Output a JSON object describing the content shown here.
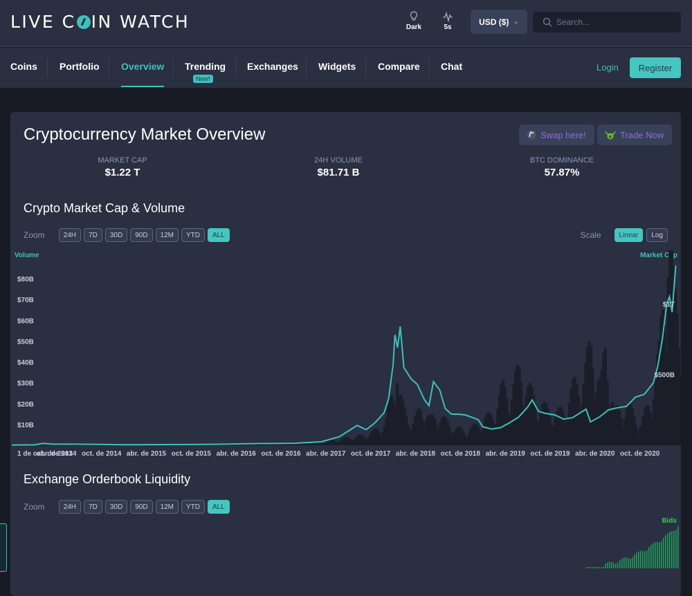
{
  "header": {
    "logo_left": "LIVE C",
    "logo_right": "IN WATCH",
    "theme_label": "Dark",
    "refresh_label": "5s",
    "currency": "USD ($)",
    "search_placeholder": "Search..."
  },
  "nav": {
    "items": [
      {
        "label": "Coins"
      },
      {
        "label": "Portfolio"
      },
      {
        "label": "Overview",
        "active": true
      },
      {
        "label": "Trending",
        "badge": "New!"
      },
      {
        "label": "Exchanges"
      },
      {
        "label": "Widgets"
      },
      {
        "label": "Compare"
      },
      {
        "label": "Chat"
      }
    ],
    "login": "Login",
    "register": "Register"
  },
  "overview": {
    "title": "Cryptocurrency Market Overview",
    "promos": [
      {
        "label": "Swap here!",
        "icon": "swap-logo-icon"
      },
      {
        "label": "Trade Now",
        "icon": "trade-logo-icon"
      }
    ],
    "stats": [
      {
        "label": "MARKET CAP",
        "value": "$1.22 T"
      },
      {
        "label": "24H VOLUME",
        "value": "$81.71 B"
      },
      {
        "label": "BTC DOMINANCE",
        "value": "57.87%"
      }
    ]
  },
  "market_chart": {
    "title": "Crypto Market Cap & Volume",
    "zoom_label": "Zoom",
    "zoom_options": [
      "24H",
      "7D",
      "30D",
      "90D",
      "12M",
      "YTD",
      "ALL"
    ],
    "zoom_selected": "ALL",
    "scale_label": "Scale",
    "scale_options": [
      "Linear",
      "Log"
    ],
    "scale_selected": "Linear",
    "left_axis_title": "Volume",
    "right_axis_title": "Market Cap"
  },
  "orderbook": {
    "title": "Exchange Orderbook Liquidity",
    "zoom_label": "Zoom",
    "zoom_options": [
      "24H",
      "7D",
      "30D",
      "90D",
      "12M",
      "YTD",
      "ALL"
    ],
    "zoom_selected": "ALL",
    "series_label": "Bids"
  },
  "chart_data": {
    "type": "area",
    "title": "Crypto Market Cap & Volume",
    "xlabel": "",
    "ylabel": "Volume",
    "y2label": "Market Cap",
    "grid": false,
    "legend": "none",
    "yticks": [
      "$10B",
      "$20B",
      "$30B",
      "$40B",
      "$50B",
      "$60B",
      "$70B",
      "$80B"
    ],
    "ylim": [
      0,
      87
    ],
    "y2ticks": [
      "$500B",
      "$1T"
    ],
    "y2lim": [
      0,
      1280
    ],
    "xticks": [
      "1 de oct. de 2013",
      "abr. de 2014",
      "oct. de 2014",
      "abr. de 2015",
      "oct. de 2015",
      "abr. de 2016",
      "oct. de 2016",
      "abr. de 2017",
      "oct. de 2017",
      "abr. de 2018",
      "oct. de 2018",
      "abr. de 2019",
      "oct. de 2019",
      "abr. de 2020",
      "oct. de 2020"
    ],
    "x_range": [
      2013.75,
      2021.2
    ],
    "series": [
      {
        "name": "Market Cap",
        "unit": "billion USD",
        "color": "#3fc1bb",
        "points": [
          [
            2013.75,
            2
          ],
          [
            2014.0,
            3
          ],
          [
            2014.1,
            13
          ],
          [
            2014.2,
            8
          ],
          [
            2014.5,
            8
          ],
          [
            2015.0,
            4
          ],
          [
            2015.5,
            5
          ],
          [
            2016.0,
            7
          ],
          [
            2016.5,
            12
          ],
          [
            2016.9,
            14
          ],
          [
            2017.2,
            25
          ],
          [
            2017.4,
            60
          ],
          [
            2017.5,
            100
          ],
          [
            2017.6,
            140
          ],
          [
            2017.7,
            110
          ],
          [
            2017.8,
            160
          ],
          [
            2017.9,
            230
          ],
          [
            2017.95,
            330
          ],
          [
            2018.0,
            570
          ],
          [
            2018.02,
            780
          ],
          [
            2018.05,
            690
          ],
          [
            2018.08,
            840
          ],
          [
            2018.12,
            550
          ],
          [
            2018.2,
            470
          ],
          [
            2018.27,
            430
          ],
          [
            2018.35,
            320
          ],
          [
            2018.4,
            280
          ],
          [
            2018.45,
            450
          ],
          [
            2018.52,
            390
          ],
          [
            2018.58,
            260
          ],
          [
            2018.65,
            220
          ],
          [
            2018.72,
            220
          ],
          [
            2018.8,
            215
          ],
          [
            2018.87,
            200
          ],
          [
            2018.95,
            180
          ],
          [
            2019.0,
            130
          ],
          [
            2019.1,
            115
          ],
          [
            2019.2,
            125
          ],
          [
            2019.3,
            160
          ],
          [
            2019.4,
            200
          ],
          [
            2019.5,
            270
          ],
          [
            2019.55,
            320
          ],
          [
            2019.62,
            240
          ],
          [
            2019.7,
            225
          ],
          [
            2019.8,
            215
          ],
          [
            2019.9,
            185
          ],
          [
            2020.0,
            195
          ],
          [
            2020.15,
            255
          ],
          [
            2020.2,
            165
          ],
          [
            2020.3,
            200
          ],
          [
            2020.4,
            250
          ],
          [
            2020.5,
            265
          ],
          [
            2020.6,
            275
          ],
          [
            2020.7,
            340
          ],
          [
            2020.8,
            360
          ],
          [
            2020.9,
            440
          ],
          [
            2020.95,
            560
          ],
          [
            2021.0,
            750
          ],
          [
            2021.05,
            1000
          ],
          [
            2021.08,
            1050
          ],
          [
            2021.11,
            940
          ],
          [
            2021.15,
            1270
          ]
        ]
      },
      {
        "name": "Volume",
        "unit": "billion USD",
        "color": "#1b1e29",
        "points": [
          [
            2013.75,
            0.1
          ],
          [
            2015.0,
            0.2
          ],
          [
            2016.0,
            0.3
          ],
          [
            2016.9,
            0.5
          ],
          [
            2017.2,
            1
          ],
          [
            2017.5,
            3
          ],
          [
            2017.7,
            4
          ],
          [
            2017.9,
            8
          ],
          [
            2018.0,
            25
          ],
          [
            2018.02,
            40
          ],
          [
            2018.05,
            20
          ],
          [
            2018.1,
            14
          ],
          [
            2018.2,
            8
          ],
          [
            2018.3,
            15
          ],
          [
            2018.4,
            10
          ],
          [
            2018.5,
            12
          ],
          [
            2018.6,
            8
          ],
          [
            2018.8,
            5
          ],
          [
            2019.0,
            10
          ],
          [
            2019.1,
            12
          ],
          [
            2019.2,
            22
          ],
          [
            2019.3,
            20
          ],
          [
            2019.4,
            30
          ],
          [
            2019.45,
            24
          ],
          [
            2019.6,
            16
          ],
          [
            2019.8,
            12
          ],
          [
            2019.9,
            14
          ],
          [
            2020.0,
            23
          ],
          [
            2020.1,
            25
          ],
          [
            2020.2,
            40
          ],
          [
            2020.3,
            22
          ],
          [
            2020.35,
            38
          ],
          [
            2020.45,
            13
          ],
          [
            2020.6,
            15
          ],
          [
            2020.75,
            8
          ],
          [
            2020.85,
            18
          ],
          [
            2020.95,
            35
          ],
          [
            2021.05,
            87
          ],
          [
            2021.12,
            55
          ]
        ]
      }
    ]
  }
}
